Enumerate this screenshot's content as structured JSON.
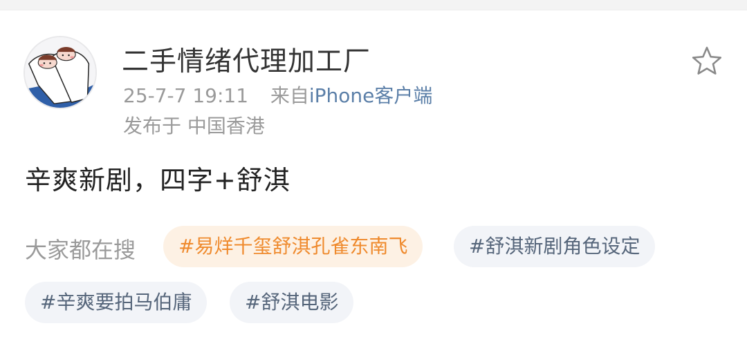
{
  "post": {
    "username": "二手情绪代理加工厂",
    "timestamp": "25-7-7 19:11",
    "source_prefix": "来自",
    "source": "iPhone客户端",
    "location": "发布于 中国香港",
    "text": "辛爽新剧，四字+舒淇"
  },
  "search": {
    "label": "大家都在搜",
    "tags": [
      {
        "label": "#易烊千玺舒淇孔雀东南飞",
        "hot": true
      },
      {
        "label": "#舒淇新剧角色设定",
        "hot": false
      },
      {
        "label": "#辛爽要拍马伯庸",
        "hot": false
      },
      {
        "label": "#舒淇电影",
        "hot": false
      }
    ]
  },
  "icons": {
    "avatar": "cartoon-avatar-icon",
    "favorite": "star-icon"
  },
  "colors": {
    "source_link": "#5b7fa8",
    "hot_tag_text": "#ef8a2d",
    "hot_tag_bg": "#fdf1e4",
    "tag_text": "#55657a",
    "tag_bg": "#f2f4f8"
  }
}
